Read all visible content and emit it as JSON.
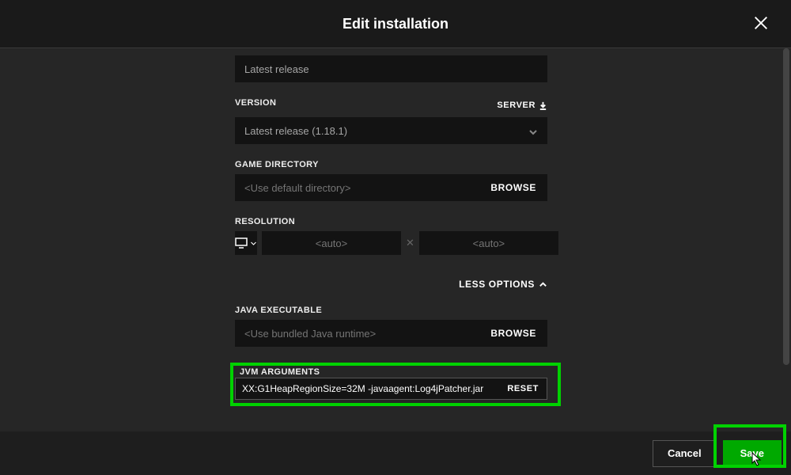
{
  "title": "Edit installation",
  "name_field": {
    "value": "Latest release"
  },
  "version": {
    "label": "VERSION",
    "server_link": "SERVER",
    "value": "Latest release (1.18.1)"
  },
  "game_directory": {
    "label": "GAME DIRECTORY",
    "placeholder": "<Use default directory>",
    "browse": "BROWSE"
  },
  "resolution": {
    "label": "RESOLUTION",
    "width": "<auto>",
    "height": "<auto>"
  },
  "less_options": "LESS OPTIONS",
  "java_exec": {
    "label": "JAVA EXECUTABLE",
    "placeholder": "<Use bundled Java runtime>",
    "browse": "BROWSE"
  },
  "jvm_args": {
    "label": "JVM ARGUMENTS",
    "value": "XX:G1HeapRegionSize=32M -javaagent:Log4jPatcher.jar",
    "reset": "RESET"
  },
  "footer": {
    "cancel": "Cancel",
    "save": "Save"
  }
}
